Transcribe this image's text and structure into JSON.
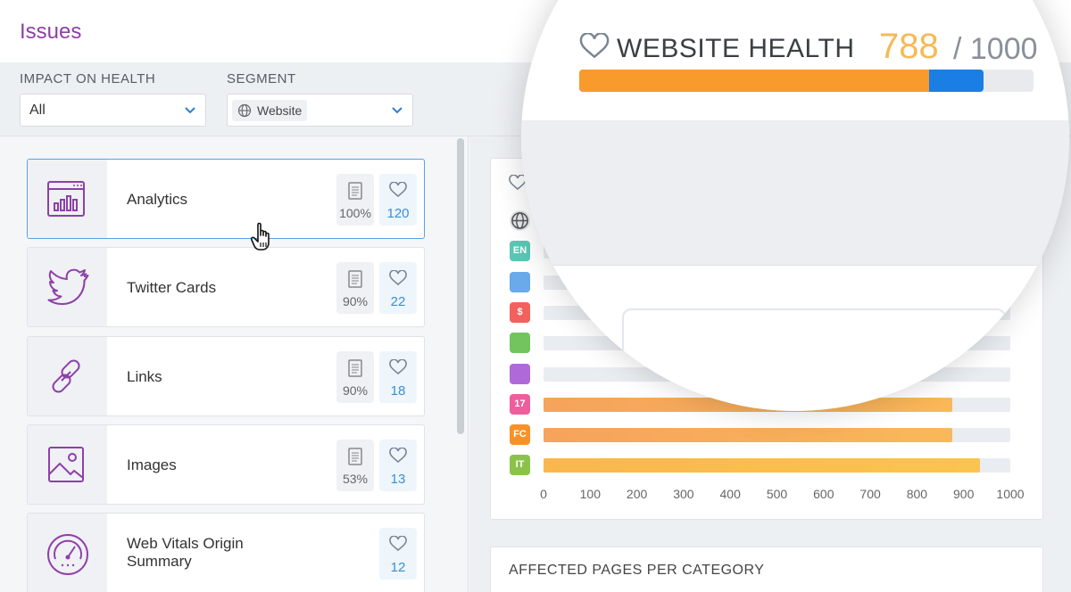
{
  "header": {
    "title": "Issues"
  },
  "filters": {
    "impact_label": "IMPACT ON HEALTH",
    "impact_value": "All",
    "segment_label": "SEGMENT",
    "segment_value": "Website"
  },
  "issues": [
    {
      "title": "Analytics",
      "icon": "analytics-icon",
      "pages": "100%",
      "health": "120",
      "active": true
    },
    {
      "title": "Twitter Cards",
      "icon": "twitter-icon",
      "pages": "90%",
      "health": "22"
    },
    {
      "title": "Links",
      "icon": "link-icon",
      "pages": "90%",
      "health": "18"
    },
    {
      "title": "Images",
      "icon": "image-icon",
      "pages": "53%",
      "health": "13"
    },
    {
      "title": "Web Vitals Origin Summary",
      "icon": "gauge-icon",
      "health": "12"
    }
  ],
  "website_health": {
    "title": "WEBSITE HEALTH",
    "score": "788",
    "max": "/ 1000",
    "score_fraction": 0.771,
    "potential_fraction": 0.89
  },
  "chart_data": {
    "type": "bar",
    "orientation": "horizontal",
    "categories": [
      "globe",
      "EN",
      "cube",
      "$",
      "robot",
      "megaphone",
      "17",
      "FC",
      "IT"
    ],
    "category_colors": [
      "#e3e6ea",
      "#5cc6b4",
      "#6aa9ea",
      "#f2615d",
      "#73c45f",
      "#b069d8",
      "#ef5e9c",
      "#f7922a",
      "#8bc34a"
    ],
    "values": [
      null,
      null,
      null,
      null,
      null,
      null,
      876,
      876,
      935
    ],
    "xlim": [
      0,
      1000
    ],
    "ticks": [
      "0",
      "100",
      "200",
      "300",
      "400",
      "500",
      "600",
      "700",
      "800",
      "900",
      "1000"
    ]
  },
  "affected": {
    "title": "AFFECTED PAGES PER CATEGORY"
  }
}
